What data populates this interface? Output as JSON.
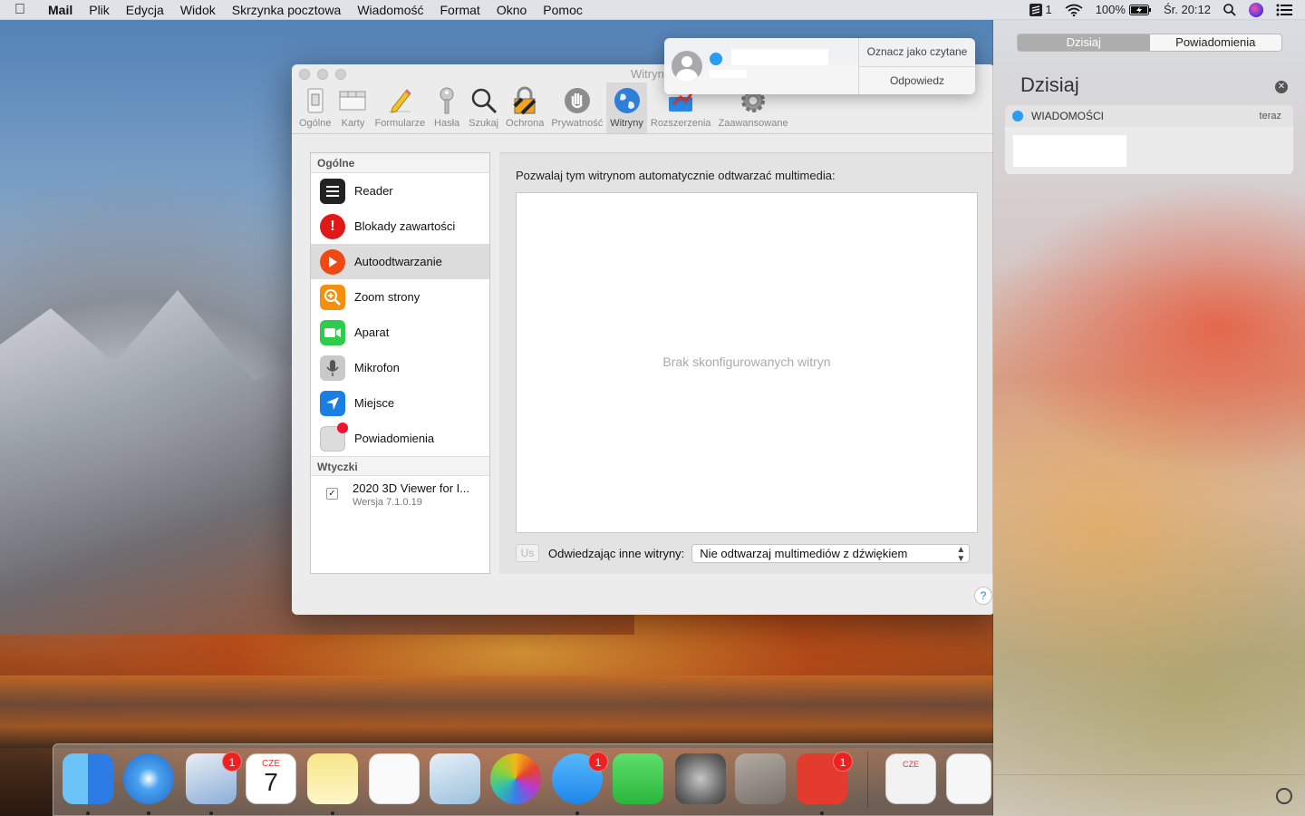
{
  "menubar": {
    "app": "Mail",
    "items": [
      "Plik",
      "Edycja",
      "Widok",
      "Skrzynka pocztowa",
      "Wiadomość",
      "Format",
      "Okno",
      "Pomoc"
    ],
    "status": {
      "badge_count": "1",
      "battery": "100%",
      "clock": "Śr. 20:12"
    }
  },
  "prefs": {
    "title": "Witryny",
    "toolbar": [
      {
        "label": "Ogólne",
        "icon": "switch-icon"
      },
      {
        "label": "Karty",
        "icon": "tabs-icon"
      },
      {
        "label": "Formularze",
        "icon": "pencil-icon"
      },
      {
        "label": "Hasła",
        "icon": "key-icon"
      },
      {
        "label": "Szukaj",
        "icon": "magnifier-icon"
      },
      {
        "label": "Ochrona",
        "icon": "lock-icon"
      },
      {
        "label": "Prywatność",
        "icon": "hand-icon"
      },
      {
        "label": "Witryny",
        "icon": "globe-icon"
      },
      {
        "label": "Rozszerzenia",
        "icon": "puzzle-icon"
      },
      {
        "label": "Zaawansowane",
        "icon": "gear-icon"
      }
    ],
    "sidebar": {
      "header_general": "Ogólne",
      "items": [
        {
          "label": "Reader",
          "icon": "reader-icon",
          "color": "#222222"
        },
        {
          "label": "Blokady zawartości",
          "icon": "content-blocker-icon",
          "color": "#e01818"
        },
        {
          "label": "Autoodtwarzanie",
          "icon": "autoplay-icon",
          "color": "#f04a14"
        },
        {
          "label": "Zoom strony",
          "icon": "zoom-icon",
          "color": "#f5900e"
        },
        {
          "label": "Aparat",
          "icon": "camera-icon",
          "color": "#2ecc4a"
        },
        {
          "label": "Mikrofon",
          "icon": "microphone-icon",
          "color": "#b8b8b8"
        },
        {
          "label": "Miejsce",
          "icon": "location-icon",
          "color": "#1a7fe0"
        },
        {
          "label": "Powiadomienia",
          "icon": "notifications-icon",
          "color": "#dcdcdc"
        }
      ],
      "header_plugins": "Wtyczki",
      "plugin": {
        "name": "2020 3D Viewer for I...",
        "version": "Wersja 7.1.0.19",
        "checkmark": "✓"
      }
    },
    "content": {
      "heading": "Pozwalaj tym witrynom automatycznie odtwarzać multimedia:",
      "empty": "Brak skonfigurowanych witryn",
      "us_button": "Us",
      "other_label": "Odwiedzając inne witryny:",
      "other_value": "Nie odtwarzaj multimediów z dźwiękiem",
      "help": "?"
    }
  },
  "banner": {
    "actions": [
      "Oznacz jako czytane",
      "Odpowiedz"
    ]
  },
  "notification_center": {
    "tabs": [
      "Dzisiaj",
      "Powiadomienia"
    ],
    "title": "Dzisiaj",
    "card": {
      "app": "WIADOMOŚCI",
      "time": "teraz"
    }
  },
  "dock": {
    "apps": [
      {
        "name": "Finder",
        "color": "#3a8ef0",
        "badge": ""
      },
      {
        "name": "Safari",
        "color": "#2a7bd6",
        "badge": ""
      },
      {
        "name": "Mail",
        "color": "#6e9cd0",
        "badge": "1"
      },
      {
        "name": "Kalendarz",
        "color": "#ffffff",
        "badge": "",
        "text_top": "CZE",
        "text_main": "7"
      },
      {
        "name": "Notatki",
        "color": "#f6e27a",
        "badge": ""
      },
      {
        "name": "Przypomnienia",
        "color": "#fafafa",
        "badge": ""
      },
      {
        "name": "Podgląd",
        "color": "#cfe2f0",
        "badge": ""
      },
      {
        "name": "Zdjęcia",
        "color": "#f4f4f4",
        "badge": ""
      },
      {
        "name": "Wiadomości",
        "color": "#2f9ff5",
        "badge": "1"
      },
      {
        "name": "FaceTime",
        "color": "#34c84a",
        "badge": ""
      },
      {
        "name": "Preferencje systemowe",
        "color": "#7b7b7b",
        "badge": ""
      },
      {
        "name": "Aplikacja",
        "color": "#8a8a8a",
        "badge": ""
      },
      {
        "name": "Todoist",
        "color": "#e33b2e",
        "badge": "1"
      },
      {
        "name": "Kalendarz dokument",
        "color": "#e8e8e8",
        "badge": "",
        "text_top": "CZE"
      },
      {
        "name": "Dokument",
        "color": "#f2f2f2",
        "badge": ""
      }
    ]
  }
}
